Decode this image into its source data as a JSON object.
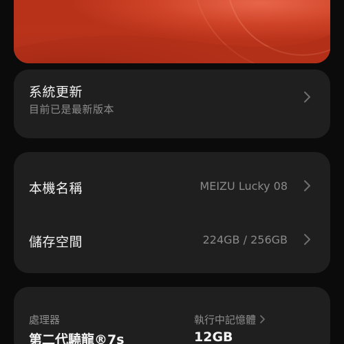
{
  "colors": {
    "background": "#0b0b0b",
    "card": "#1f1f1f",
    "hero_accent": "#c23a1f",
    "text_primary": "#f4f4f4",
    "text_secondary": "#8d8d8d"
  },
  "system_update": {
    "title": "系統更新",
    "status": "目前已是最新版本",
    "icon": "chevron-right-icon"
  },
  "device_info": {
    "name_label": "本機名稱",
    "name_value": "MEIZU Lucky 08",
    "storage_label": "儲存空間",
    "storage_value": "224GB / 256GB",
    "icon": "chevron-right-icon"
  },
  "specs": {
    "processor_label": "處理器",
    "processor_value": "第二代驍龍®7s",
    "memory_label": "執行中記憶體",
    "memory_value": "12GB"
  }
}
